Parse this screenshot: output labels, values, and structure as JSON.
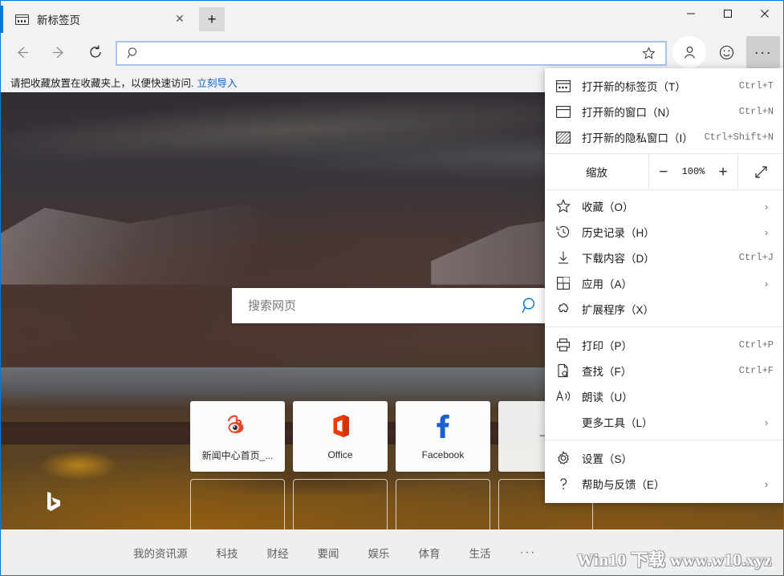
{
  "window": {
    "minimize_label": "—",
    "maximize_label": "□",
    "close_label": "✕"
  },
  "tabs": {
    "items": [
      {
        "title": "新标签页",
        "close_label": "✕"
      }
    ],
    "new_tab_label": "+"
  },
  "nav": {
    "back_label": "←",
    "forward_label": "→",
    "refresh_label": "↻"
  },
  "address": {
    "value": "",
    "placeholder": "",
    "search_icon": "search-icon",
    "star_icon": "favorite-star-icon"
  },
  "toolbar": {
    "profile_icon": "person-icon",
    "feedback_icon": "smiley-icon",
    "more_label": "···"
  },
  "favbar": {
    "text": "请把收藏放置在收藏夹上，以便快速访问.",
    "link": "立刻导入"
  },
  "newtab": {
    "search": {
      "placeholder": "搜索网页",
      "value": "",
      "button_icon": "search-icon"
    },
    "tiles": [
      {
        "label": "新闻中心首页_...",
        "icon": "weibo-icon"
      },
      {
        "label": "Office",
        "icon": "office-icon"
      },
      {
        "label": "Facebook",
        "icon": "facebook-icon"
      },
      {
        "label": "",
        "icon": "add-tile-icon",
        "add": true
      }
    ],
    "ghost_tiles": 4,
    "bing_logo": "bing-logo"
  },
  "newsnav": {
    "items": [
      "我的资讯源",
      "科技",
      "财经",
      "要闻",
      "娱乐",
      "体育",
      "生活"
    ],
    "more_label": "···"
  },
  "watermark": {
    "text": "Win10  下载  www.w10.xyz"
  },
  "menu": {
    "items": [
      {
        "id": "new-tab",
        "icon": "new-tab-icon",
        "label": "打开新的标签页（T）",
        "accel": "Ctrl+T",
        "chevron": ""
      },
      {
        "id": "new-window",
        "icon": "new-window-icon",
        "label": "打开新的窗口（N）",
        "accel": "Ctrl+N",
        "chevron": ""
      },
      {
        "id": "new-inprivate",
        "icon": "inprivate-window-icon",
        "label": "打开新的隐私窗口（I）",
        "accel": "Ctrl+Shift+N",
        "chevron": ""
      }
    ],
    "zoom": {
      "label": "缩放",
      "minus_label": "−",
      "value": "100%",
      "plus_label": "+",
      "fullscreen_icon": "fullscreen-icon"
    },
    "items2": [
      {
        "id": "favorites",
        "icon": "star-icon",
        "label": "收藏（O）",
        "accel": "",
        "chevron": "›"
      },
      {
        "id": "history",
        "icon": "history-icon",
        "label": "历史记录（H）",
        "accel": "",
        "chevron": "›"
      },
      {
        "id": "downloads",
        "icon": "download-icon",
        "label": "下载内容（D）",
        "accel": "Ctrl+J",
        "chevron": ""
      },
      {
        "id": "apps",
        "icon": "apps-icon",
        "label": "应用（A）",
        "accel": "",
        "chevron": "›"
      },
      {
        "id": "extensions",
        "icon": "extension-icon",
        "label": "扩展程序（X）",
        "accel": "",
        "chevron": ""
      }
    ],
    "items3": [
      {
        "id": "print",
        "icon": "print-icon",
        "label": "打印（P）",
        "accel": "Ctrl+P",
        "chevron": ""
      },
      {
        "id": "find",
        "icon": "find-icon",
        "label": "查找（F）",
        "accel": "Ctrl+F",
        "chevron": ""
      },
      {
        "id": "read-aloud",
        "icon": "read-aloud-icon",
        "label": "朗读（U）",
        "accel": "",
        "chevron": ""
      },
      {
        "id": "more-tools",
        "icon": "",
        "label": "更多工具（L）",
        "accel": "",
        "chevron": "›"
      }
    ],
    "items4": [
      {
        "id": "settings",
        "icon": "gear-icon",
        "label": "设置（S）",
        "accel": "",
        "chevron": ""
      },
      {
        "id": "help",
        "icon": "help-icon",
        "label": "帮助与反馈（E）",
        "accel": "",
        "chevron": "›"
      }
    ]
  },
  "colors": {
    "accent": "#0078d7",
    "chrome_bg": "#f2f2f2",
    "link": "#0a60c8",
    "menu_bg": "#ffffff",
    "news_bg": "#f0efed"
  }
}
